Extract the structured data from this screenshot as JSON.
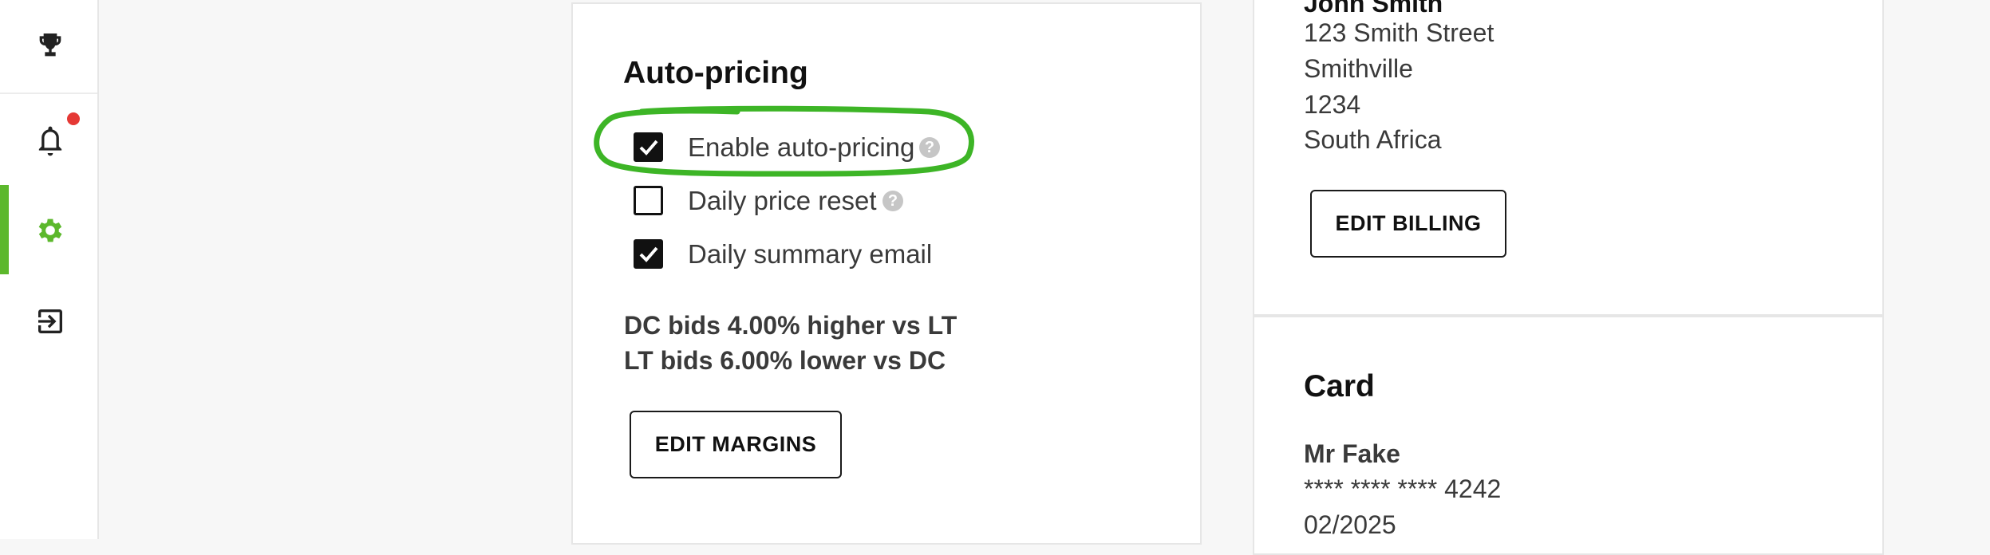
{
  "theme": {
    "accent": "#5cb82c",
    "notification": "#e53935",
    "annotation": "#3db526"
  },
  "sidebar": {
    "items": [
      {
        "icon": "trophy-icon"
      },
      {
        "icon": "bell-icon",
        "has_notification": true
      },
      {
        "icon": "gear-icon",
        "active": true
      },
      {
        "icon": "logout-icon"
      }
    ]
  },
  "auto_pricing": {
    "title": "Auto-pricing",
    "options": [
      {
        "label": "Enable auto-pricing",
        "checked": true,
        "help": "?"
      },
      {
        "label": "Daily price reset",
        "checked": false,
        "help": "?"
      },
      {
        "label": "Daily summary email",
        "checked": true
      }
    ],
    "margins": [
      "DC bids 4.00% higher vs LT",
      "LT bids 6.00% lower vs DC"
    ],
    "edit_margins_label": "EDIT MARGINS"
  },
  "billing": {
    "name": "John Smith",
    "address": [
      "123 Smith Street",
      "Smithville",
      "1234",
      "South Africa"
    ],
    "edit_billing_label": "EDIT BILLING"
  },
  "card": {
    "title": "Card",
    "holder": "Mr Fake",
    "number": "**** **** **** 4242",
    "expiry": "02/2025"
  }
}
